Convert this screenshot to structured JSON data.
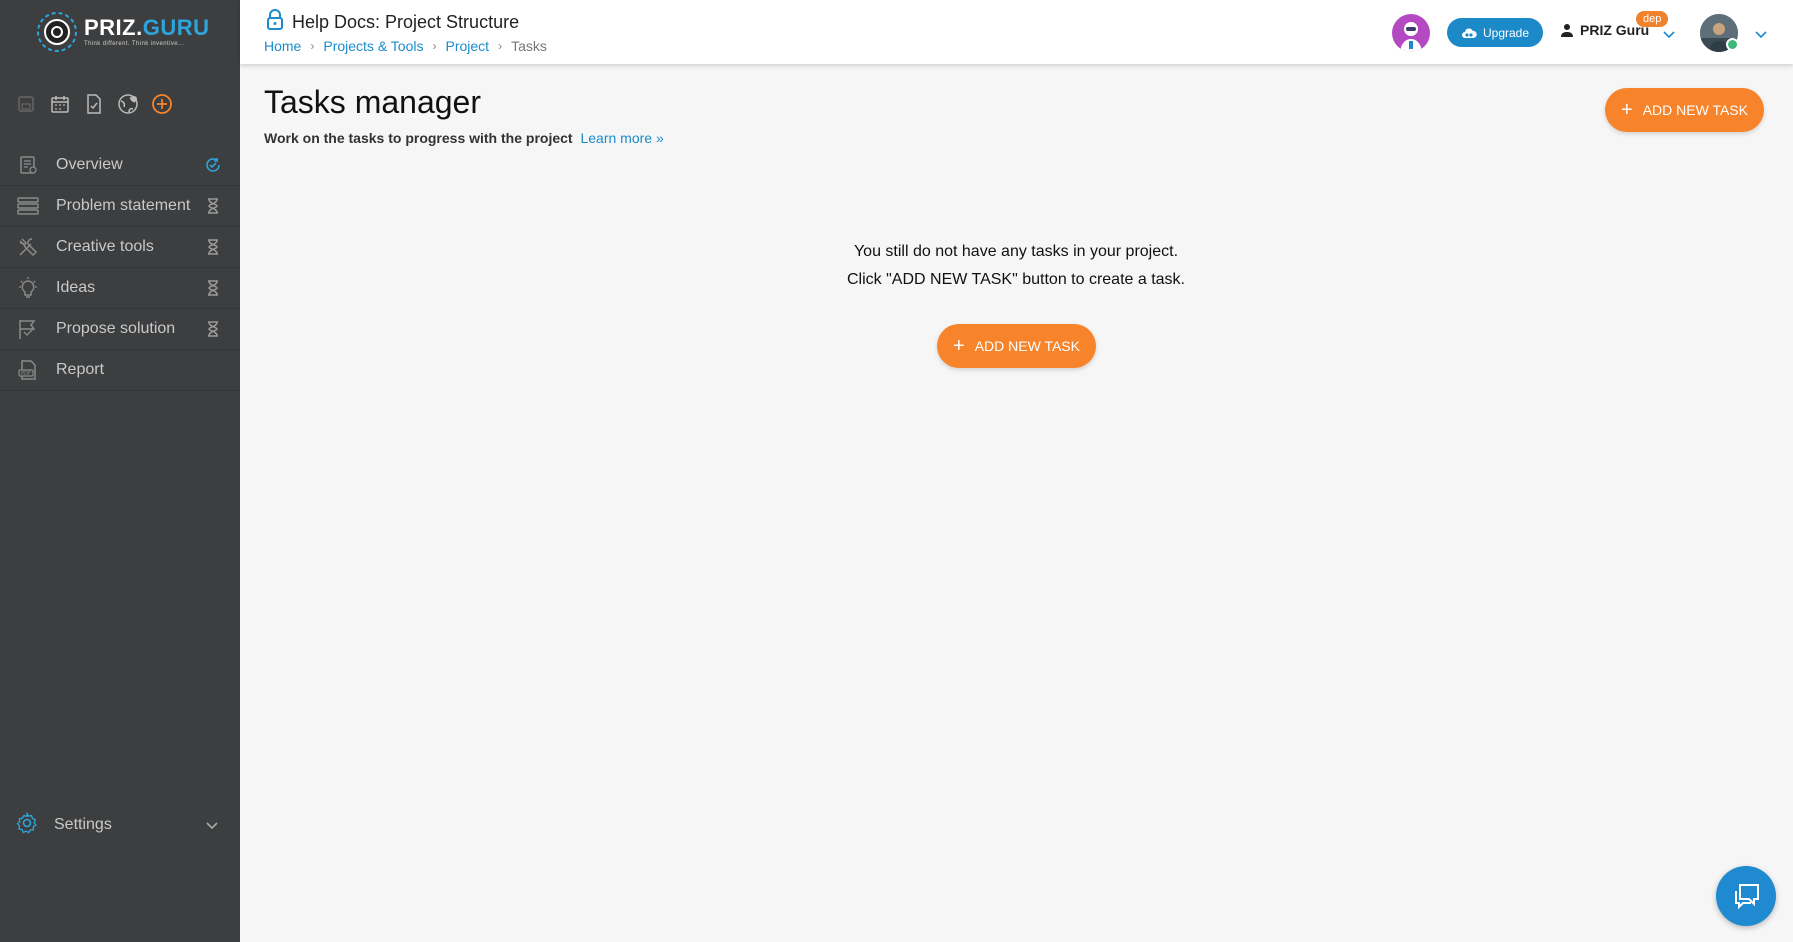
{
  "brand": {
    "name_part1": "PRIZ.",
    "name_part2": "GURU",
    "tagline": "Think different. Think inventive..."
  },
  "header": {
    "title": "Help Docs: Project Structure",
    "breadcrumb": [
      "Home",
      "Projects & Tools",
      "Project",
      "Tasks"
    ],
    "upgrade_label": "Upgrade",
    "account_name": "PRIZ Guru",
    "account_badge": "dep"
  },
  "sidebar": {
    "quick_icons": [
      "save-icon",
      "calendar-icon",
      "document-check-icon",
      "globe-icon",
      "add-circle-icon"
    ],
    "items": [
      {
        "label": "Overview",
        "icon": "overview-icon",
        "status": "in-progress"
      },
      {
        "label": "Problem statement",
        "icon": "layers-icon",
        "status": "pending"
      },
      {
        "label": "Creative tools",
        "icon": "tools-icon",
        "status": "pending"
      },
      {
        "label": "Ideas",
        "icon": "lightbulb-icon",
        "status": "pending"
      },
      {
        "label": "Propose solution",
        "icon": "flag-icon",
        "status": "pending"
      },
      {
        "label": "Report",
        "icon": "pdf-icon",
        "status": ""
      }
    ],
    "settings_label": "Settings"
  },
  "main": {
    "title": "Tasks manager",
    "subtitle": "Work on the tasks to progress with the project",
    "learn_more": "Learn more »",
    "add_task_label": "ADD NEW TASK",
    "empty_line1": "You still do not have any tasks in your project.",
    "empty_line2": "Click \"ADD NEW TASK\" button to create a task."
  },
  "colors": {
    "accent": "#f7832a",
    "link": "#1a8ccc",
    "sidebar_bg": "#3d3e3f",
    "upgrade_bg": "#1c89c9"
  }
}
